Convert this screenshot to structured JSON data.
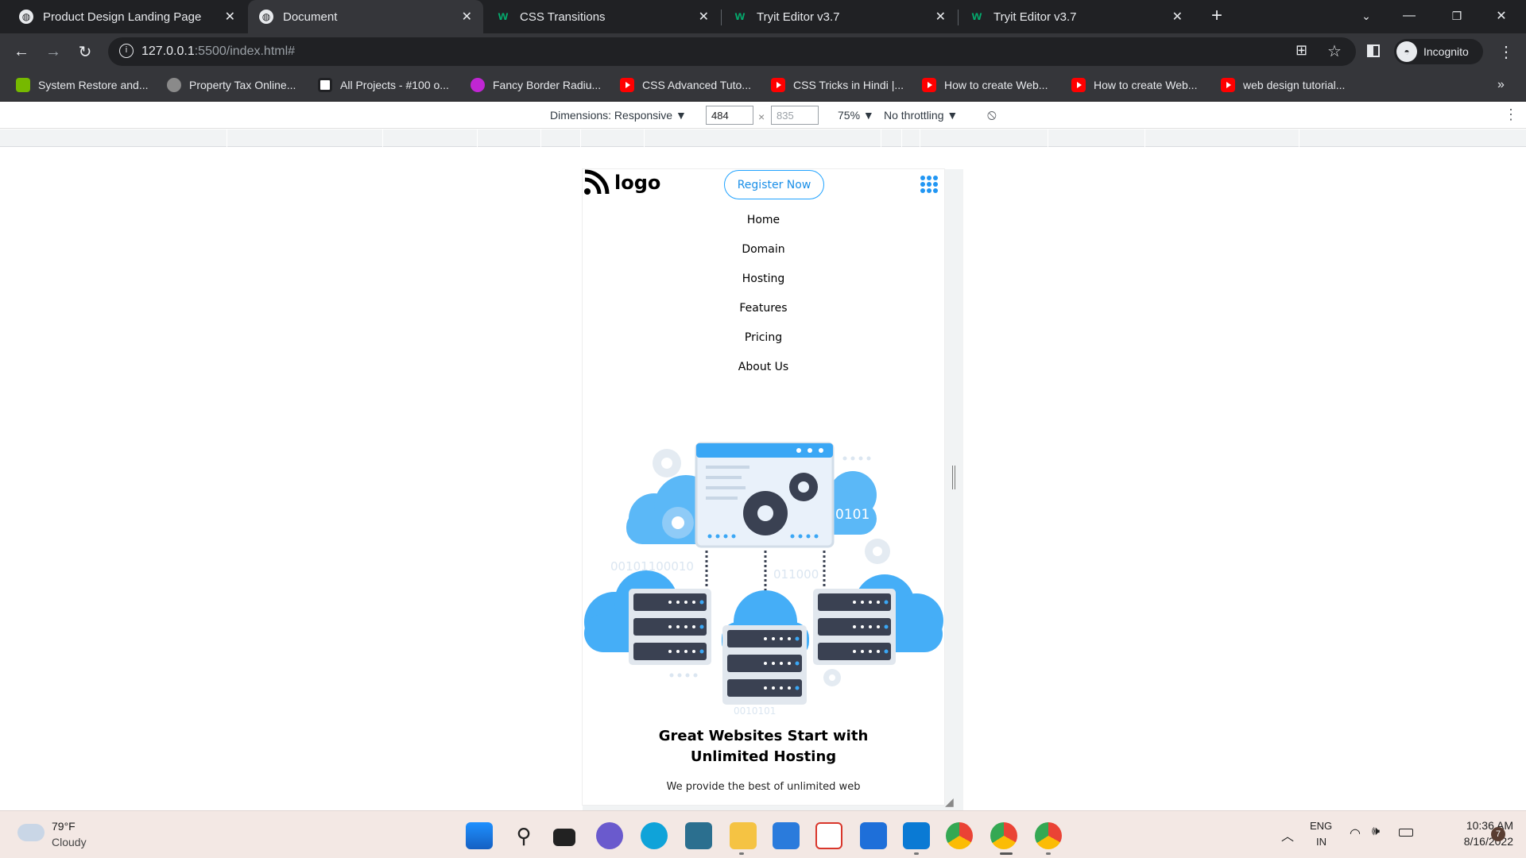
{
  "browser": {
    "tabs": [
      {
        "title": "Product Design Landing Page",
        "active": false
      },
      {
        "title": "Document",
        "active": true
      },
      {
        "title": "CSS Transitions",
        "active": false
      },
      {
        "title": "Tryit Editor v3.7",
        "active": false
      },
      {
        "title": "Tryit Editor v3.7",
        "active": false
      }
    ],
    "url_host": "127.0.0.1",
    "url_rest": ":5500/index.html#",
    "profile_label": "Incognito",
    "bookmarks": [
      "System Restore and...",
      "Property Tax Online...",
      "All Projects - #100 o...",
      "Fancy Border Radiu...",
      "CSS Advanced Tuto...",
      "CSS Tricks in Hindi |...",
      "How to create Web...",
      "How to create Web...",
      "web design tutorial..."
    ]
  },
  "devtools": {
    "dimensions_label": "Dimensions: Responsive ▼",
    "width_value": "484",
    "height_value": "835",
    "times": "×",
    "zoom": "75% ▼",
    "throttling": "No throttling ▼"
  },
  "page": {
    "logo_text": "logo",
    "register_label": "Register Now",
    "nav": [
      "Home",
      "Domain",
      "Hosting",
      "Features",
      "Pricing",
      "About Us"
    ],
    "hero_title_line1": "Great Websites Start with",
    "hero_title_line2": "Unlimited Hosting",
    "hero_sub": "We provide the best of unlimited web",
    "illustration_text": [
      "0101",
      "00101100010",
      "011000",
      "0010101"
    ]
  },
  "taskbar": {
    "weather_temp": "79°F",
    "weather_desc": "Cloudy",
    "lang_top": "ENG",
    "lang_bottom": "IN",
    "time": "10:36 AM",
    "date": "8/16/2022",
    "notif_count": "7"
  },
  "colors": {
    "accent": "#1fa2ff",
    "chrome_dark": "#202124",
    "chrome_toolbar": "#35363a",
    "illustration_blue": "#3aa7f5",
    "server_dark": "#3a4152"
  }
}
